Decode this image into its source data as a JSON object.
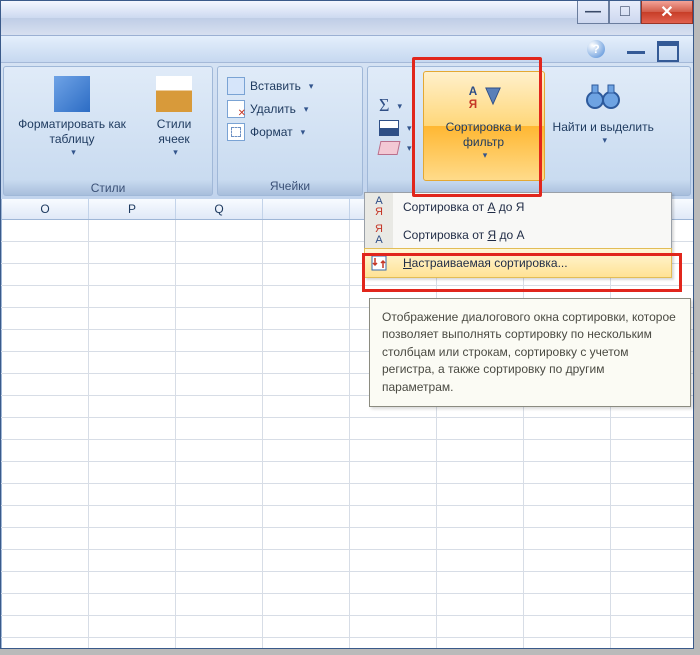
{
  "ribbon": {
    "styles_group": {
      "label": "Стили",
      "format_table": "Форматировать как таблицу",
      "cell_styles": "Стили ячеек"
    },
    "cells_group": {
      "label": "Ячейки",
      "insert": "Вставить",
      "delete": "Удалить",
      "format": "Формат"
    },
    "editing_group": {
      "sum": "Σ",
      "sort_filter": "Сортировка и фильтр",
      "find_select": "Найти и выделить"
    }
  },
  "menu": {
    "sort_az": "Сортировка от А до Я",
    "sort_za": "Сортировка от Я до А",
    "custom_sort": "Настраиваемая сортировка..."
  },
  "tooltip": {
    "text": "Отображение диалогового окна сортировки, которое позволяет выполнять сортировку по нескольким столбцам или строкам, сортировку с учетом регистра, а также сортировку по другим параметрам."
  },
  "columns": [
    "O",
    "P",
    "Q"
  ],
  "icons": {
    "sort_az": "А\nЯ",
    "sort_za": "Я\nА",
    "custom": "⇵"
  }
}
